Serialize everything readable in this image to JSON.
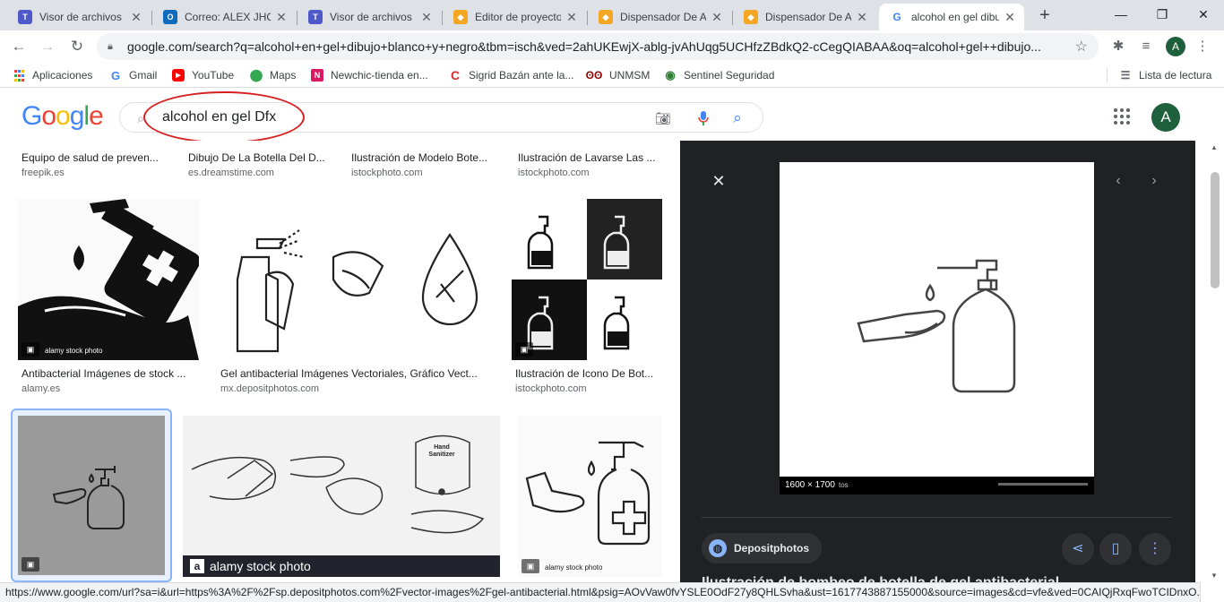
{
  "browser": {
    "tabs": [
      {
        "title": "Visor de archivos M",
        "icon": "teams-icon",
        "color": "#5059c9",
        "active": false
      },
      {
        "title": "Correo: ALEX JHON",
        "icon": "outlook-icon",
        "color": "#0f6cbd",
        "active": false
      },
      {
        "title": "Visor de archivos M",
        "icon": "teams-icon",
        "color": "#5059c9",
        "active": false
      },
      {
        "title": "Editor de proyecto",
        "icon": "tinkercad-icon",
        "color": "#f5a623",
        "active": false
      },
      {
        "title": "Dispensador De Al",
        "icon": "tinkercad-icon",
        "color": "#f5a623",
        "active": false
      },
      {
        "title": "Dispensador De Al",
        "icon": "tinkercad-icon",
        "color": "#f5a623",
        "active": false
      },
      {
        "title": "alcohol en gel dibu",
        "icon": "google-icon",
        "color": "#4285f4",
        "active": true
      }
    ],
    "url": "google.com/search?q=alcohol+en+gel+dibujo+blanco+y+negro&tbm=isch&ved=2ahUKEwjX-ablg-jvAhUqg5UCHfzZBdkQ2-cCegQIABAA&oq=alcohol+gel++dibujo...",
    "profile_initial": "A",
    "bookmarks": [
      {
        "label": "Aplicaciones",
        "icon": "apps-grid-icon",
        "color": "#4285f4"
      },
      {
        "label": "Gmail",
        "icon": "google-g-icon",
        "color": "#4285f4"
      },
      {
        "label": "YouTube",
        "icon": "youtube-icon",
        "color": "#ff0000"
      },
      {
        "label": "Maps",
        "icon": "maps-pin-icon",
        "color": "#34a853"
      },
      {
        "label": "Newchic-tienda en...",
        "icon": "newchic-icon",
        "color": "#d81b60"
      },
      {
        "label": "Sigrid Bazán ante la...",
        "icon": "c-logo-icon",
        "color": "#d32f2f"
      },
      {
        "label": "UNMSM",
        "icon": "unmsm-icon",
        "color": "#8b0000"
      },
      {
        "label": "Sentinel Seguridad",
        "icon": "eye-icon",
        "color": "#2e7d32"
      }
    ],
    "reading_list": "Lista de lectura"
  },
  "google": {
    "logo": "Google",
    "query": "alcohol en gel Dfx",
    "account_initial": "A"
  },
  "results": {
    "row1": [
      {
        "title": "Equipo de salud de preven...",
        "source": "freepik.es"
      },
      {
        "title": "Dibujo De La Botella Del D...",
        "source": "es.dreamstime.com"
      },
      {
        "title": "Ilustración de Modelo Bote...",
        "source": "istockphoto.com"
      },
      {
        "title": "Ilustración de Lavarse Las ...",
        "source": "istockphoto.com"
      }
    ],
    "row2": [
      {
        "title": "Antibacterial Imágenes de stock ...",
        "source": "alamy.es",
        "watermark": "alamy stock photo"
      },
      {
        "title": "Gel antibacterial Imágenes Vectoriales, Gráfico Vect...",
        "source": "mx.depositphotos.com"
      },
      {
        "title": "Ilustración de Icono De Bot...",
        "source": "istockphoto.com"
      }
    ],
    "row3": [
      {
        "title": "",
        "source": ""
      },
      {
        "title": "",
        "source": "",
        "watermark": "alamy stock photo",
        "sanitizer_label": "Hand Sanitizer"
      },
      {
        "title": "",
        "source": "",
        "watermark": "alamy stock photo"
      }
    ]
  },
  "preview": {
    "dimensions": "1600 × 1700",
    "watermark": "tos",
    "source": "Depositphotos",
    "title": "Ilustración de bombeo de botella de gel antibacterial"
  },
  "status_url": "https://www.google.com/url?sa=i&url=https%3A%2F%2Fsp.depositphotos.com%2Fvector-images%2Fgel-antibacterial.html&psig=AOvVaw0fvYSLE0OdF27y8QHLSvha&ust=1617743887155000&source=images&cd=vfe&ved=0CAIQjRxqFwoTCIDnxO..."
}
